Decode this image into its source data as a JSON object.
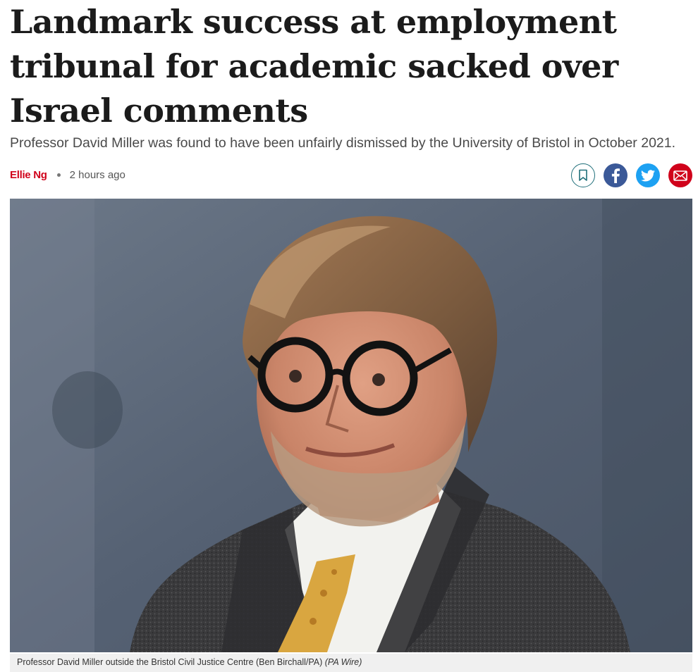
{
  "article": {
    "headline": "Landmark success at employment tribunal for academic sacked over Israel comments",
    "standfirst": "Professor David Miller was found to have been unfairly dismissed by the University of Bristol in October 2021.",
    "author": "Ellie Ng",
    "published": "2 hours ago"
  },
  "share": {
    "icons": [
      "bookmark-icon",
      "facebook-icon",
      "twitter-icon",
      "email-icon"
    ],
    "colors": {
      "bookmark_border": "#1f6f7a",
      "facebook": "#3b5998",
      "twitter": "#1da1f2",
      "email": "#d0021b"
    }
  },
  "image": {
    "caption": "Professor David Miller outside the Bristol Civil Justice Centre (Ben Birchall/PA)",
    "credit": "(PA Wire)"
  },
  "theme": {
    "accent": "#d0021b"
  }
}
